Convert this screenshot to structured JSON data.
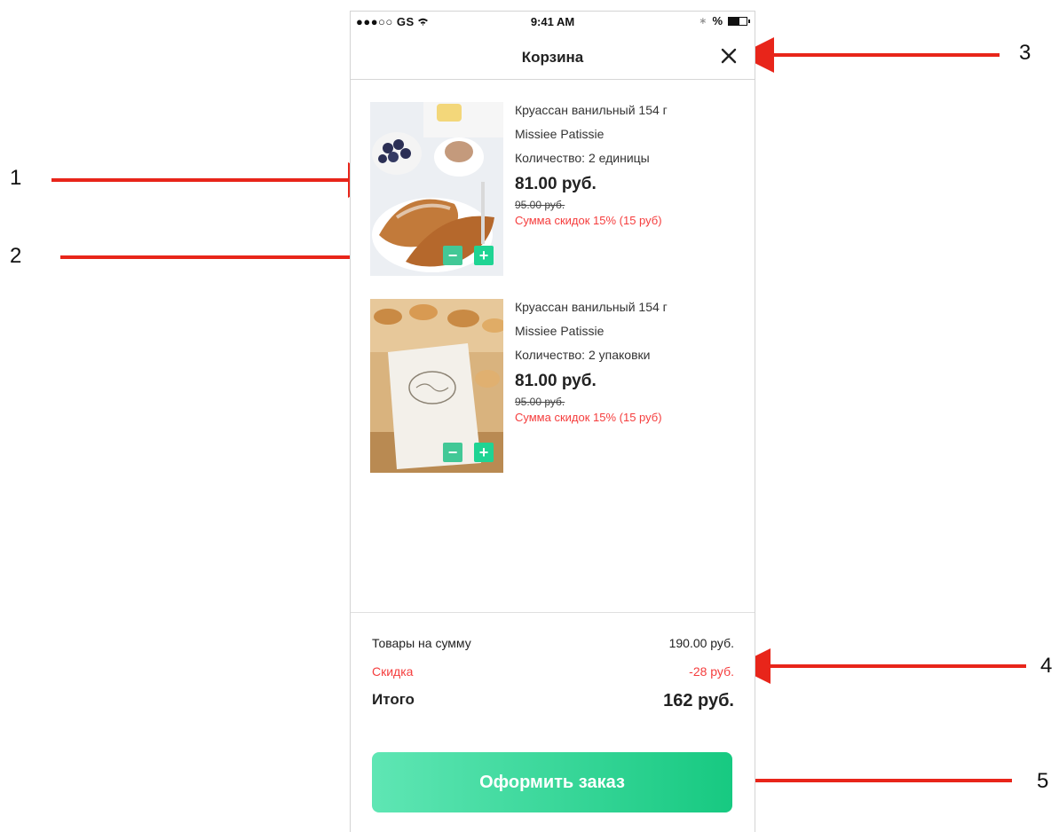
{
  "status_bar": {
    "carrier": "●●●○○ GS",
    "time": "9:41 AM",
    "battery": "%"
  },
  "header": {
    "title": "Корзина",
    "close_icon": "close-icon"
  },
  "items": [
    {
      "name": "Круассан ванильный 154 г",
      "brand": "Missiee Patissie",
      "quantity": "Количество: 2 единицы",
      "price": "81.00 руб.",
      "old_price": "95.00 руб.",
      "discount": "Сумма скидок 15% (15 руб)",
      "minus": "−",
      "plus": "+"
    },
    {
      "name": "Круассан ванильный 154 г",
      "brand": "Missiee Patissie",
      "quantity": "Количество: 2 упаковки",
      "price": "81.00 руб.",
      "old_price": "95.00 руб.",
      "discount": "Сумма скидок 15% (15 руб)",
      "minus": "−",
      "plus": "+"
    }
  ],
  "summary": {
    "goods_label": "Товары на сумму",
    "goods_value": "190.00 руб.",
    "discount_label": "Скидка",
    "discount_value": "-28 руб.",
    "total_label": "Итого",
    "total_value": "162 руб."
  },
  "checkout_label": "Оформить заказ",
  "callouts": [
    "1",
    "2",
    "3",
    "4",
    "5"
  ],
  "colors": {
    "accent_green": "#1fd493",
    "discount_red": "#f53d3d",
    "arrow_red": "#e8251a"
  }
}
